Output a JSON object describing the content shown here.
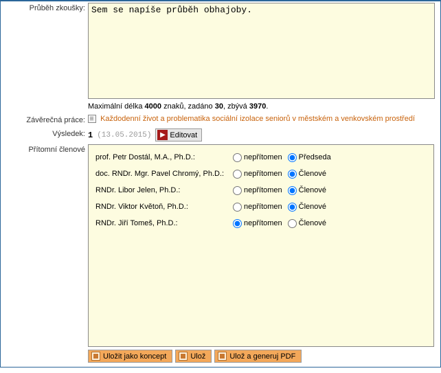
{
  "labels": {
    "exam_course": "Průběh zkoušky:",
    "thesis": "Závěrečná práce:",
    "result": "Výsledek:",
    "members": "Přítomní členové"
  },
  "exam_course_text": "Sem se napíše průběh obhajoby.",
  "maxlen": {
    "prefix": "Maximální délka ",
    "max": "4000",
    "mid1": " znaků, zadáno ",
    "entered": "30",
    "mid2": ", zbývá ",
    "remain": "3970",
    "suffix": "."
  },
  "thesis_title": "Každodenní život a problematika sociální izolace seniorů v městském a venkovském prostředí",
  "result": {
    "number": "1",
    "date": "(13.05.2015)",
    "edit": "Editovat"
  },
  "members": [
    {
      "name": "prof. Petr Dostál, M.A., Ph.D.:",
      "absent": false,
      "role": "Předseda",
      "selected": "role"
    },
    {
      "name": "doc. RNDr. Mgr. Pavel Chromý, Ph.D.:",
      "absent": false,
      "role": "Členové",
      "selected": "role"
    },
    {
      "name": "RNDr. Libor Jelen, Ph.D.:",
      "absent": false,
      "role": "Členové",
      "selected": "role"
    },
    {
      "name": "RNDr. Viktor Květoň, Ph.D.:",
      "absent": false,
      "role": "Členové",
      "selected": "role"
    },
    {
      "name": "RNDr. Jiří Tomeš, Ph.D.:",
      "absent": true,
      "role": "Členové",
      "selected": "absent"
    }
  ],
  "options": {
    "absent": "nepřítomen"
  },
  "buttons": {
    "save_draft": "Uložit jako koncept",
    "save": "Ulož",
    "save_pdf": "Ulož a generuj PDF"
  }
}
